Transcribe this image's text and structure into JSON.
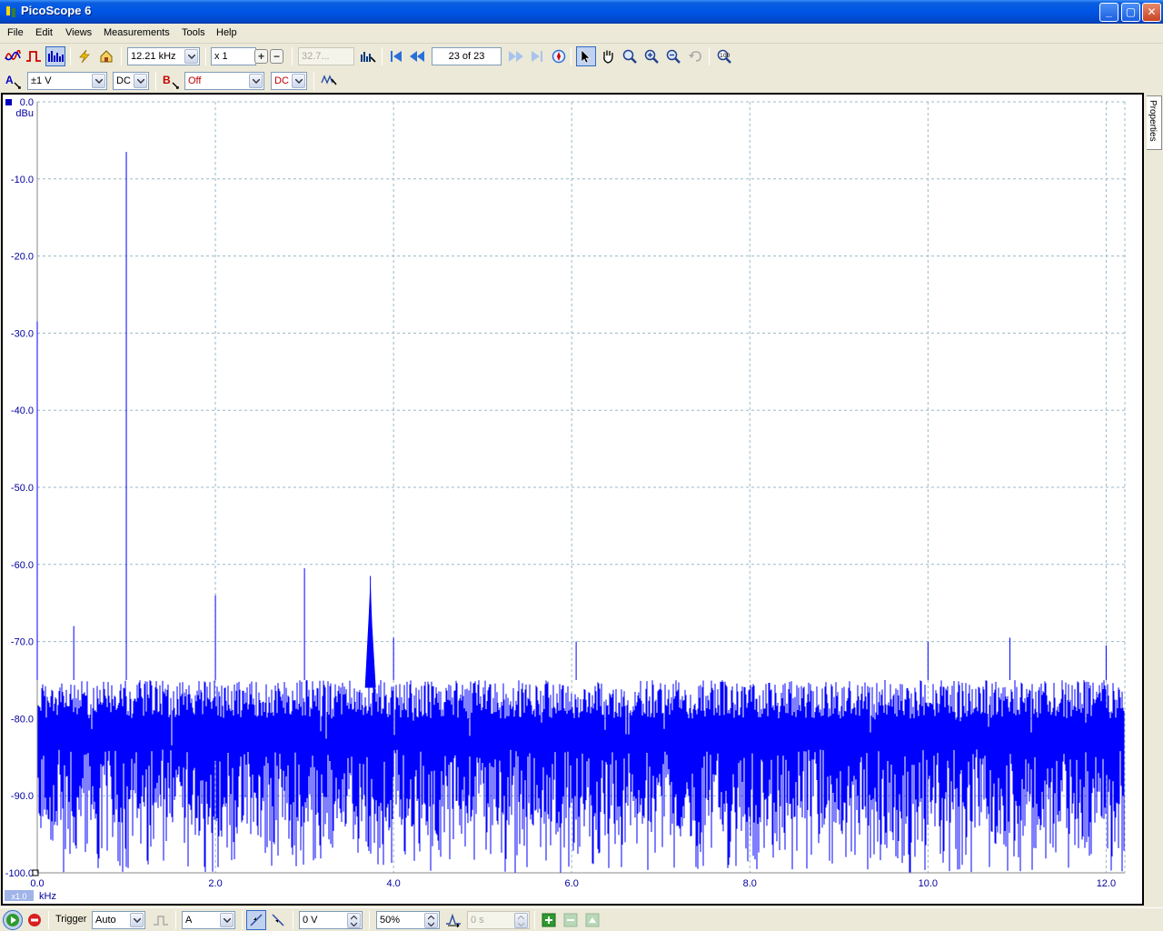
{
  "window": {
    "title": "PicoScope 6",
    "minimize": "_",
    "maximize": "▢",
    "close": "✕"
  },
  "menu": {
    "items": [
      "File",
      "Edit",
      "Views",
      "Measurements",
      "Tools",
      "Help"
    ]
  },
  "toolbar": {
    "timebase": "12.21 kHz",
    "zoom": "x 1",
    "samples": "32.7...",
    "buffer": "23 of 23"
  },
  "channels": {
    "a": {
      "label": "A",
      "range": "±1 V",
      "coupling": "DC"
    },
    "b": {
      "label": "B",
      "range": "Off",
      "coupling": "DC"
    }
  },
  "properties_tab": "Properties",
  "trigger": {
    "label": "Trigger",
    "mode": "Auto",
    "source": "A",
    "threshold": "0 V",
    "pre_trigger": "50%",
    "delay": "0 s"
  },
  "colors": {
    "trace": "#0000ff",
    "grid": "#9ab8c8",
    "axis_text": "#0000a0"
  },
  "chart_data": {
    "type": "line",
    "xlabel": "kHz",
    "ylabel": "dBu",
    "x_unit": "kHz",
    "y_unit": "dBu",
    "xlim": [
      0.0,
      12.21
    ],
    "ylim": [
      -100.0,
      0.0
    ],
    "x_ticks": [
      "0.0",
      "2.0",
      "4.0",
      "6.0",
      "8.0",
      "10.0",
      "12.0"
    ],
    "y_ticks": [
      "0.0",
      "-10.0",
      "-20.0",
      "-30.0",
      "-40.0",
      "-50.0",
      "-60.0",
      "-70.0",
      "-80.0",
      "-90.0",
      "-100.0"
    ],
    "x_zoom_label": "x1.0",
    "noise_floor_dbu": [
      -100.0,
      -75.0
    ],
    "series": [
      {
        "peaks": [
          {
            "x": 0.0,
            "y": -28.5
          },
          {
            "x": 0.41,
            "y": -68.0
          },
          {
            "x": 1.0,
            "y": -6.5
          },
          {
            "x": 2.0,
            "y": -64.0
          },
          {
            "x": 3.0,
            "y": -60.5
          },
          {
            "x": 3.74,
            "y": -61.5
          },
          {
            "x": 4.0,
            "y": -69.5
          },
          {
            "x": 6.05,
            "y": -70.0
          },
          {
            "x": 10.0,
            "y": -70.0
          },
          {
            "x": 10.92,
            "y": -69.5
          },
          {
            "x": 12.0,
            "y": -70.5
          }
        ]
      }
    ]
  }
}
